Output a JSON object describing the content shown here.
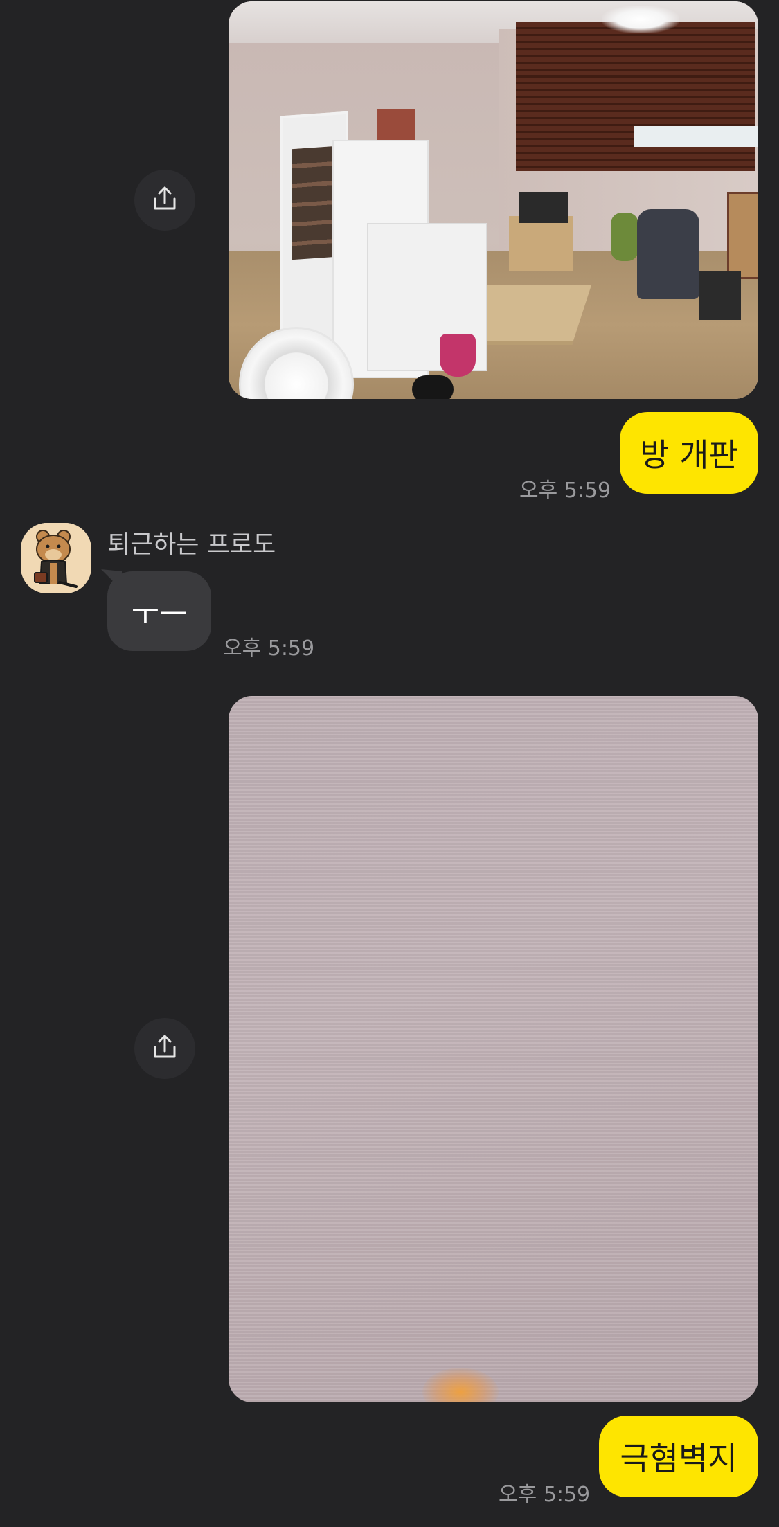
{
  "messages": {
    "msg1": {
      "photo_desc": "room-photo",
      "share_icon": "share-icon"
    },
    "msg2": {
      "text": "방 개판",
      "time": "오후 5:59"
    },
    "msg3": {
      "sender": "퇴근하는 프로도",
      "avatar_icon": "frodo-avatar",
      "text": "ㅜㅡ",
      "time": "오후 5:59"
    },
    "msg4": {
      "photo_desc": "wallpaper-photo",
      "share_icon": "share-icon"
    },
    "msg5": {
      "text": "극혐벽지",
      "time": "오후 5:59"
    }
  },
  "colors": {
    "background": "#232325",
    "my_bubble": "#fee500",
    "friend_bubble": "#3a3a3d",
    "timestamp": "#9a9a9d"
  }
}
